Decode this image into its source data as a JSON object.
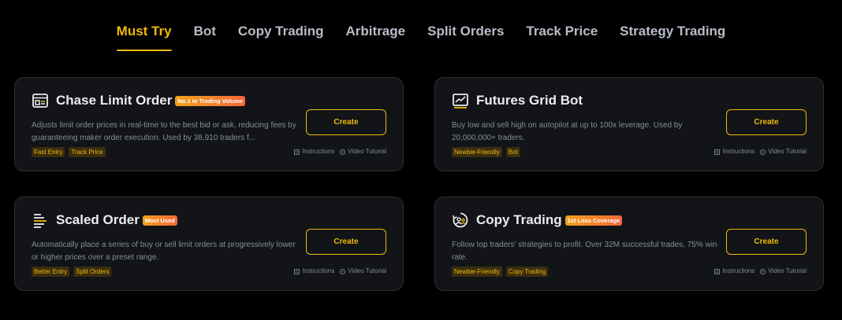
{
  "tabs": [
    {
      "label": "Must Try",
      "active": true
    },
    {
      "label": "Bot",
      "active": false
    },
    {
      "label": "Copy Trading",
      "active": false
    },
    {
      "label": "Arbitrage",
      "active": false
    },
    {
      "label": "Split Orders",
      "active": false
    },
    {
      "label": "Track Price",
      "active": false
    },
    {
      "label": "Strategy Trading",
      "active": false
    }
  ],
  "cards": [
    {
      "title": "Chase Limit Order",
      "badge": "No.1 in Trading Volume",
      "icon": "chase-limit-order-icon",
      "description": "Adjusts limit order prices in real-time to the best bid or ask, reducing fees by guaranteeing maker order execution. Used by 38,910 traders f...",
      "tags": [
        "Fast Entry",
        "Track Price"
      ],
      "button": "Create",
      "instructions": "Instructions",
      "video": "Video Tutorial"
    },
    {
      "title": "Futures Grid Bot",
      "badge": "",
      "icon": "grid-chart-icon",
      "description": "Buy low and sell high on autopilot at up to 100x leverage. Used by 20,000,000+ traders.",
      "tags": [
        "Newbie-Friendly",
        "Bot"
      ],
      "button": "Create",
      "instructions": "Instructions",
      "video": "Video Tutorial"
    },
    {
      "title": "Scaled Order",
      "badge": "Most Used",
      "icon": "scaled-lines-icon",
      "description": "Automatically place a series of buy or sell limit orders at progressively lower or higher prices over a preset range.",
      "tags": [
        "Better Entry",
        "Split Orders"
      ],
      "button": "Create",
      "instructions": "Instructions",
      "video": "Video Tutorial"
    },
    {
      "title": "Copy Trading",
      "badge": "1st Loss Coverage",
      "icon": "copy-trading-icon",
      "description": "Follow top traders' strategies to profit. Over 32M successful trades, 75% win rate.",
      "tags": [
        "Newbie-Friendly",
        "Copy Trading"
      ],
      "button": "Create",
      "instructions": "Instructions",
      "video": "Video Tutorial"
    }
  ],
  "colors": {
    "accent": "#f0b90b",
    "background": "#000000",
    "card": "#121418",
    "muted": "#848e9c"
  }
}
